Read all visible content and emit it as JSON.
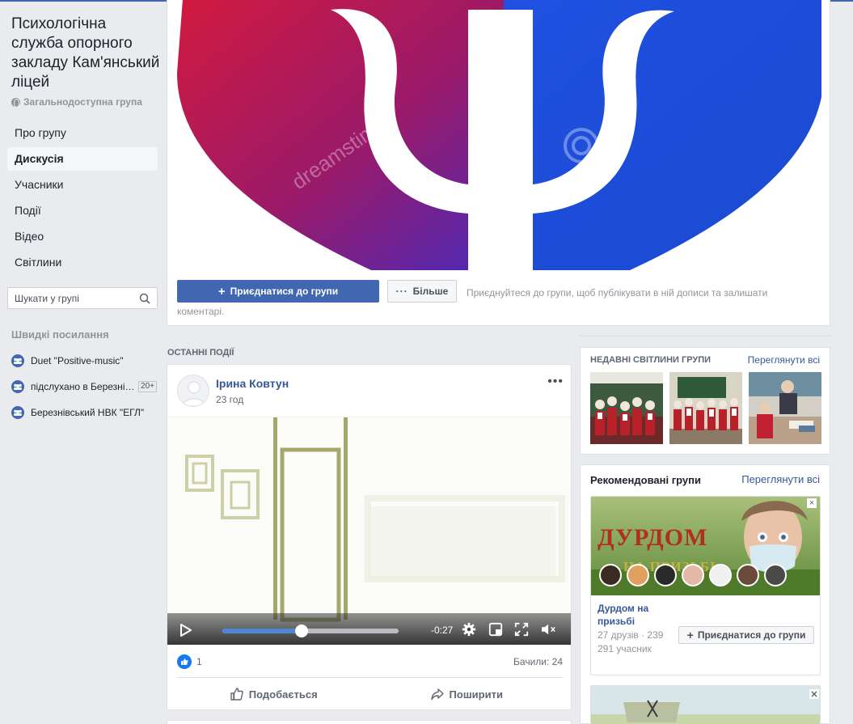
{
  "group": {
    "title": "Психологічна служба опорного закладу Кам'янський ліцей",
    "privacy": "Загальнодоступна група"
  },
  "nav": {
    "items": [
      {
        "label": "Про групу",
        "active": false
      },
      {
        "label": "Дискусія",
        "active": true
      },
      {
        "label": "Учасники",
        "active": false
      },
      {
        "label": "Події",
        "active": false
      },
      {
        "label": "Відео",
        "active": false
      },
      {
        "label": "Світлини",
        "active": false
      }
    ]
  },
  "search": {
    "placeholder": "Шукати у групі",
    "value": ""
  },
  "quick_links": {
    "title": "Швидкі посилання",
    "items": [
      {
        "label": "Duet \"Positive-music\"",
        "badge": ""
      },
      {
        "label": "підслухано в Березнівському",
        "badge": "20+"
      },
      {
        "label": "Березнівський НВК \"ЕГЛ\"",
        "badge": ""
      }
    ]
  },
  "cover": {
    "watermark": "dreamstime",
    "join_label": "Приєднатися до групи",
    "more_label": "Більше",
    "hint": "Приєднуйтеся до групи, щоб публікувати в ній дописи та залишати коментарі."
  },
  "recent_events": {
    "label": "ОСТАННІ ПОДІЇ"
  },
  "post": {
    "author": "Ірина Ковтун",
    "time": "23 год",
    "video": {
      "time_remaining": "-0:27",
      "progress": 0.45
    },
    "likes": "1",
    "views": "Бачили: 24",
    "like_label": "Подобається",
    "share_label": "Поширити"
  },
  "photos": {
    "title": "НЕДАВНІ СВІТЛИНИ ГРУПИ",
    "see_all": "Переглянути всі"
  },
  "recommended": {
    "title": "Рекомендовані групи",
    "see_all": "Переглянути всі",
    "group": {
      "banner_text": "ДУРДОМ",
      "banner_subtext": "НА ПРИЗЬБІ",
      "name": "Дурдом на призьбі",
      "meta": "27 друзів · 239 291 учасник",
      "join_label": "Приєднатися до групи"
    }
  },
  "colors": {
    "fb_blue": "#4267b2",
    "link": "#365899",
    "background": "#e9ebee",
    "heart_red": "#c8143c",
    "heart_blue": "#1e50dc"
  }
}
